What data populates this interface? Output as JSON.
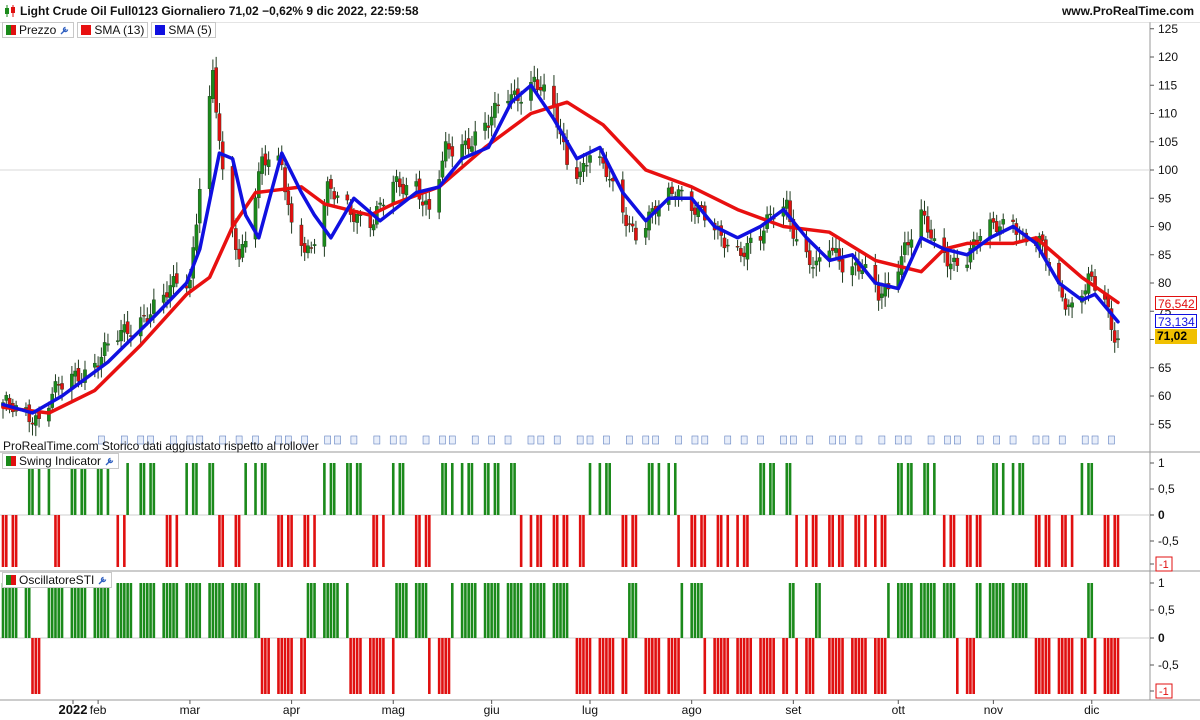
{
  "header": {
    "title": "Light Crude Oil Full0123 Giornaliero 71,02 −0,62% 9 dic 2022, 22:59:58",
    "site": "www.ProRealTime.com"
  },
  "note": "ProRealTime.com Storico dati aggiustato rispetto al rollover",
  "panels": {
    "price": {
      "legend": [
        "Prezzo",
        "SMA (13)",
        "SMA (5)"
      ]
    },
    "swing": {
      "legend": "Swing Indicator"
    },
    "sti": {
      "legend": "OscillatoreSTI"
    }
  },
  "colors": {
    "up": "#1b8a1b",
    "down": "#e01010",
    "sma13": "#e81010",
    "sma5": "#1010e0",
    "last_bg": "#f0c000"
  },
  "chart_data": [
    {
      "type": "candlestick",
      "title": "Light Crude Oil Full0123 Giornaliero",
      "x_tick_labels": [
        "2022",
        "feb",
        "mar",
        "apr",
        "mag",
        "giu",
        "lug",
        "ago",
        "set",
        "ott",
        "nov",
        "dic"
      ],
      "y_tick_labels": [
        "125",
        "120",
        "115",
        "110",
        "105",
        "100",
        "95",
        "90",
        "85",
        "80",
        "75",
        "70",
        "65",
        "60",
        "55"
      ],
      "ylim": [
        52,
        126
      ],
      "grid": false,
      "legend": "top-left",
      "last_values": {
        "price": "71,02",
        "sma13": "76,542",
        "sma5": "73,134"
      },
      "close_path": [
        {
          "d": "2022-01-03",
          "v": 58
        },
        {
          "d": "2022-01-10",
          "v": 57.5
        },
        {
          "d": "2022-01-14",
          "v": 56
        },
        {
          "d": "2022-01-18",
          "v": 60
        },
        {
          "d": "2022-01-24",
          "v": 63
        },
        {
          "d": "2022-01-31",
          "v": 66
        },
        {
          "d": "2022-02-07",
          "v": 70
        },
        {
          "d": "2022-02-14",
          "v": 74
        },
        {
          "d": "2022-02-21",
          "v": 77
        },
        {
          "d": "2022-02-25",
          "v": 80
        },
        {
          "d": "2022-03-01",
          "v": 80.5
        },
        {
          "d": "2022-03-04",
          "v": 98
        },
        {
          "d": "2022-03-08",
          "v": 117
        },
        {
          "d": "2022-03-11",
          "v": 98
        },
        {
          "d": "2022-03-16",
          "v": 84
        },
        {
          "d": "2022-03-23",
          "v": 102
        },
        {
          "d": "2022-03-29",
          "v": 100
        },
        {
          "d": "2022-04-01",
          "v": 90
        },
        {
          "d": "2022-04-07",
          "v": 86
        },
        {
          "d": "2022-04-12",
          "v": 96
        },
        {
          "d": "2022-04-19",
          "v": 93
        },
        {
          "d": "2022-04-26",
          "v": 91
        },
        {
          "d": "2022-05-02",
          "v": 97
        },
        {
          "d": "2022-05-09",
          "v": 98
        },
        {
          "d": "2022-05-13",
          "v": 92
        },
        {
          "d": "2022-05-18",
          "v": 103
        },
        {
          "d": "2022-05-24",
          "v": 105
        },
        {
          "d": "2022-05-31",
          "v": 108
        },
        {
          "d": "2022-06-06",
          "v": 113
        },
        {
          "d": "2022-06-10",
          "v": 114
        },
        {
          "d": "2022-06-14",
          "v": 116
        },
        {
          "d": "2022-06-20",
          "v": 110
        },
        {
          "d": "2022-06-24",
          "v": 102
        },
        {
          "d": "2022-06-28",
          "v": 100
        },
        {
          "d": "2022-07-01",
          "v": 103
        },
        {
          "d": "2022-07-06",
          "v": 99
        },
        {
          "d": "2022-07-11",
          "v": 93
        },
        {
          "d": "2022-07-15",
          "v": 89
        },
        {
          "d": "2022-07-22",
          "v": 93
        },
        {
          "d": "2022-07-28",
          "v": 97
        },
        {
          "d": "2022-08-03",
          "v": 93
        },
        {
          "d": "2022-08-09",
          "v": 88
        },
        {
          "d": "2022-08-15",
          "v": 86
        },
        {
          "d": "2022-08-22",
          "v": 88
        },
        {
          "d": "2022-08-26",
          "v": 92
        },
        {
          "d": "2022-08-30",
          "v": 94
        },
        {
          "d": "2022-09-02",
          "v": 88
        },
        {
          "d": "2022-09-08",
          "v": 82
        },
        {
          "d": "2022-09-12",
          "v": 86
        },
        {
          "d": "2022-09-16",
          "v": 84
        },
        {
          "d": "2022-09-22",
          "v": 83
        },
        {
          "d": "2022-09-27",
          "v": 77
        },
        {
          "d": "2022-09-30",
          "v": 79
        },
        {
          "d": "2022-10-05",
          "v": 87
        },
        {
          "d": "2022-10-10",
          "v": 92
        },
        {
          "d": "2022-10-14",
          "v": 86
        },
        {
          "d": "2022-10-19",
          "v": 84
        },
        {
          "d": "2022-10-24",
          "v": 85
        },
        {
          "d": "2022-10-28",
          "v": 88
        },
        {
          "d": "2022-11-02",
          "v": 90
        },
        {
          "d": "2022-11-07",
          "v": 92
        },
        {
          "d": "2022-11-10",
          "v": 88
        },
        {
          "d": "2022-11-16",
          "v": 86
        },
        {
          "d": "2022-11-21",
          "v": 79
        },
        {
          "d": "2022-11-25",
          "v": 76
        },
        {
          "d": "2022-11-30",
          "v": 80
        },
        {
          "d": "2022-12-05",
          "v": 77
        },
        {
          "d": "2022-12-07",
          "v": 72
        },
        {
          "d": "2022-12-09",
          "v": 71.02
        }
      ],
      "series": [
        {
          "name": "Prezzo"
        },
        {
          "name": "SMA (13)",
          "points": [
            {
              "d": "2022-01-03",
              "v": 58
            },
            {
              "d": "2022-01-17",
              "v": 57
            },
            {
              "d": "2022-01-31",
              "v": 61
            },
            {
              "d": "2022-02-14",
              "v": 69
            },
            {
              "d": "2022-02-28",
              "v": 78
            },
            {
              "d": "2022-03-07",
              "v": 81
            },
            {
              "d": "2022-03-14",
              "v": 90
            },
            {
              "d": "2022-03-21",
              "v": 96
            },
            {
              "d": "2022-03-28",
              "v": 96.5
            },
            {
              "d": "2022-04-04",
              "v": 97
            },
            {
              "d": "2022-04-11",
              "v": 94
            },
            {
              "d": "2022-04-18",
              "v": 93
            },
            {
              "d": "2022-04-25",
              "v": 92
            },
            {
              "d": "2022-05-02",
              "v": 94
            },
            {
              "d": "2022-05-16",
              "v": 97
            },
            {
              "d": "2022-05-30",
              "v": 104
            },
            {
              "d": "2022-06-13",
              "v": 110
            },
            {
              "d": "2022-06-24",
              "v": 112
            },
            {
              "d": "2022-07-05",
              "v": 108
            },
            {
              "d": "2022-07-18",
              "v": 100
            },
            {
              "d": "2022-08-01",
              "v": 97
            },
            {
              "d": "2022-08-15",
              "v": 93
            },
            {
              "d": "2022-08-29",
              "v": 90
            },
            {
              "d": "2022-09-12",
              "v": 89
            },
            {
              "d": "2022-09-26",
              "v": 84
            },
            {
              "d": "2022-10-10",
              "v": 82
            },
            {
              "d": "2022-10-17",
              "v": 86
            },
            {
              "d": "2022-10-24",
              "v": 87
            },
            {
              "d": "2022-11-07",
              "v": 87
            },
            {
              "d": "2022-11-14",
              "v": 88
            },
            {
              "d": "2022-11-28",
              "v": 81
            },
            {
              "d": "2022-12-09",
              "v": 76.542
            }
          ]
        },
        {
          "name": "SMA (5)",
          "points": [
            {
              "d": "2022-01-03",
              "v": 58.5
            },
            {
              "d": "2022-01-12",
              "v": 57
            },
            {
              "d": "2022-01-21",
              "v": 60
            },
            {
              "d": "2022-02-04",
              "v": 66
            },
            {
              "d": "2022-02-18",
              "v": 74
            },
            {
              "d": "2022-02-28",
              "v": 80
            },
            {
              "d": "2022-03-04",
              "v": 86
            },
            {
              "d": "2022-03-10",
              "v": 103
            },
            {
              "d": "2022-03-14",
              "v": 102
            },
            {
              "d": "2022-03-18",
              "v": 92
            },
            {
              "d": "2022-03-22",
              "v": 88
            },
            {
              "d": "2022-03-29",
              "v": 103
            },
            {
              "d": "2022-04-04",
              "v": 96
            },
            {
              "d": "2022-04-08",
              "v": 92
            },
            {
              "d": "2022-04-13",
              "v": 88
            },
            {
              "d": "2022-04-20",
              "v": 95
            },
            {
              "d": "2022-04-28",
              "v": 91
            },
            {
              "d": "2022-05-09",
              "v": 96
            },
            {
              "d": "2022-05-16",
              "v": 97
            },
            {
              "d": "2022-05-23",
              "v": 102
            },
            {
              "d": "2022-05-31",
              "v": 104
            },
            {
              "d": "2022-06-07",
              "v": 112
            },
            {
              "d": "2022-06-13",
              "v": 115
            },
            {
              "d": "2022-06-20",
              "v": 109
            },
            {
              "d": "2022-06-27",
              "v": 102
            },
            {
              "d": "2022-07-04",
              "v": 104
            },
            {
              "d": "2022-07-11",
              "v": 96
            },
            {
              "d": "2022-07-18",
              "v": 91
            },
            {
              "d": "2022-07-25",
              "v": 95
            },
            {
              "d": "2022-08-01",
              "v": 95
            },
            {
              "d": "2022-08-08",
              "v": 90
            },
            {
              "d": "2022-08-15",
              "v": 88
            },
            {
              "d": "2022-08-22",
              "v": 90
            },
            {
              "d": "2022-08-29",
              "v": 93
            },
            {
              "d": "2022-09-05",
              "v": 88
            },
            {
              "d": "2022-09-12",
              "v": 84
            },
            {
              "d": "2022-09-19",
              "v": 85
            },
            {
              "d": "2022-09-26",
              "v": 80
            },
            {
              "d": "2022-10-03",
              "v": 79
            },
            {
              "d": "2022-10-10",
              "v": 88
            },
            {
              "d": "2022-10-17",
              "v": 86
            },
            {
              "d": "2022-10-24",
              "v": 85
            },
            {
              "d": "2022-10-31",
              "v": 88
            },
            {
              "d": "2022-11-07",
              "v": 90
            },
            {
              "d": "2022-11-14",
              "v": 87
            },
            {
              "d": "2022-11-21",
              "v": 80
            },
            {
              "d": "2022-11-28",
              "v": 77
            },
            {
              "d": "2022-12-02",
              "v": 78
            },
            {
              "d": "2022-12-09",
              "v": 73.134
            }
          ]
        }
      ]
    },
    {
      "type": "bar",
      "title": "Swing Indicator",
      "y_tick_labels": [
        "1",
        "0,5",
        "0",
        "-0,5",
        "-1"
      ],
      "ylim": [
        -1.1,
        1.1
      ],
      "signal_runs": [
        {
          "from": "2022-01-03",
          "to": "2022-01-07",
          "v": -1
        },
        {
          "from": "2022-01-10",
          "to": "2022-01-17",
          "v": 1
        },
        {
          "from": "2022-01-18",
          "to": "2022-01-21",
          "v": -1
        },
        {
          "from": "2022-01-24",
          "to": "2022-02-04",
          "v": 1
        },
        {
          "from": "2022-02-07",
          "to": "2022-02-09",
          "v": -1
        },
        {
          "from": "2022-02-10",
          "to": "2022-02-21",
          "v": 1
        },
        {
          "from": "2022-02-22",
          "to": "2022-02-25",
          "v": -1
        },
        {
          "from": "2022-02-28",
          "to": "2022-03-08",
          "v": 1
        },
        {
          "from": "2022-03-09",
          "to": "2022-03-16",
          "v": -1
        },
        {
          "from": "2022-03-17",
          "to": "2022-03-24",
          "v": 1
        },
        {
          "from": "2022-03-25",
          "to": "2022-04-08",
          "v": -1
        },
        {
          "from": "2022-04-11",
          "to": "2022-04-22",
          "v": 1
        },
        {
          "from": "2022-04-25",
          "to": "2022-04-29",
          "v": -1
        },
        {
          "from": "2022-05-02",
          "to": "2022-05-06",
          "v": 1
        },
        {
          "from": "2022-05-09",
          "to": "2022-05-13",
          "v": -1
        },
        {
          "from": "2022-05-16",
          "to": "2022-06-08",
          "v": 1
        },
        {
          "from": "2022-06-09",
          "to": "2022-06-30",
          "v": -1
        },
        {
          "from": "2022-07-01",
          "to": "2022-07-08",
          "v": 1
        },
        {
          "from": "2022-07-11",
          "to": "2022-07-15",
          "v": -1
        },
        {
          "from": "2022-07-18",
          "to": "2022-07-27",
          "v": 1
        },
        {
          "from": "2022-07-28",
          "to": "2022-08-19",
          "v": -1
        },
        {
          "from": "2022-08-22",
          "to": "2022-08-31",
          "v": 1
        },
        {
          "from": "2022-09-01",
          "to": "2022-09-30",
          "v": -1
        },
        {
          "from": "2022-10-03",
          "to": "2022-10-14",
          "v": 1
        },
        {
          "from": "2022-10-17",
          "to": "2022-10-28",
          "v": -1
        },
        {
          "from": "2022-10-31",
          "to": "2022-11-10",
          "v": 1
        },
        {
          "from": "2022-11-11",
          "to": "2022-11-25",
          "v": -1
        },
        {
          "from": "2022-11-28",
          "to": "2022-12-02",
          "v": 1
        },
        {
          "from": "2022-12-05",
          "to": "2022-12-09",
          "v": -1
        }
      ]
    },
    {
      "type": "bar",
      "title": "OscillatoreSTI",
      "y_tick_labels": [
        "1",
        "0,5",
        "0",
        "-0,5",
        "-1"
      ],
      "ylim": [
        -1.1,
        1.1
      ],
      "signal_runs": [
        {
          "from": "2022-01-03",
          "to": "2022-01-11",
          "v": 1
        },
        {
          "from": "2022-01-12",
          "to": "2022-01-14",
          "v": -1
        },
        {
          "from": "2022-01-17",
          "to": "2022-03-22",
          "v": 1
        },
        {
          "from": "2022-03-23",
          "to": "2022-04-05",
          "v": -1
        },
        {
          "from": "2022-04-06",
          "to": "2022-04-18",
          "v": 1
        },
        {
          "from": "2022-04-19",
          "to": "2022-05-02",
          "v": -1
        },
        {
          "from": "2022-05-03",
          "to": "2022-05-12",
          "v": 1
        },
        {
          "from": "2022-05-13",
          "to": "2022-05-19",
          "v": -1
        },
        {
          "from": "2022-05-20",
          "to": "2022-06-24",
          "v": 1
        },
        {
          "from": "2022-06-27",
          "to": "2022-07-12",
          "v": -1
        },
        {
          "from": "2022-07-13",
          "to": "2022-07-15",
          "v": 1
        },
        {
          "from": "2022-07-18",
          "to": "2022-07-28",
          "v": -1
        },
        {
          "from": "2022-07-29",
          "to": "2022-08-04",
          "v": 1
        },
        {
          "from": "2022-08-05",
          "to": "2022-08-30",
          "v": -1
        },
        {
          "from": "2022-08-31",
          "to": "2022-09-01",
          "v": 1
        },
        {
          "from": "2022-09-02",
          "to": "2022-09-07",
          "v": -1
        },
        {
          "from": "2022-09-08",
          "to": "2022-09-09",
          "v": 1
        },
        {
          "from": "2022-09-12",
          "to": "2022-09-29",
          "v": -1
        },
        {
          "from": "2022-09-30",
          "to": "2022-10-20",
          "v": 1
        },
        {
          "from": "2022-10-21",
          "to": "2022-10-26",
          "v": -1
        },
        {
          "from": "2022-10-27",
          "to": "2022-11-11",
          "v": 1
        },
        {
          "from": "2022-11-14",
          "to": "2022-11-29",
          "v": -1
        },
        {
          "from": "2022-11-30",
          "to": "2022-12-01",
          "v": 1
        },
        {
          "from": "2022-12-02",
          "to": "2022-12-09",
          "v": -1
        }
      ]
    }
  ]
}
